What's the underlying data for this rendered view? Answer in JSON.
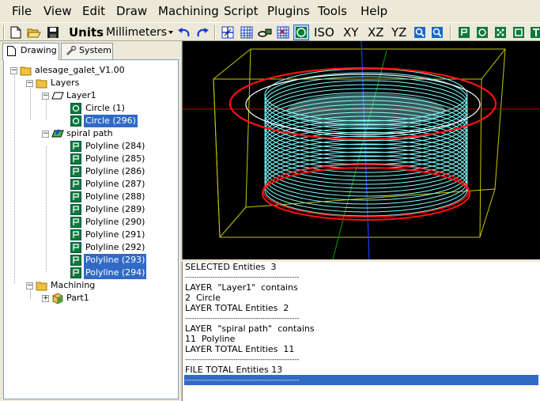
{
  "menu": [
    "File",
    "View",
    "Edit",
    "Draw",
    "Machining",
    "Script",
    "Plugins",
    "Tools",
    "Help"
  ],
  "toolbar": {
    "units_label": "Units",
    "units_value": "Millimeters",
    "view_iso": "ISO",
    "view_xy": "XY",
    "view_xz": "XZ",
    "view_yz": "YZ"
  },
  "tabs": {
    "drawing": "Drawing",
    "system": "System"
  },
  "tree": {
    "root": "alesage_galet_V1.00",
    "layers": "Layers",
    "layer1": "Layer1",
    "layer1_items": [
      "Circle (1)",
      "Circle (296)"
    ],
    "spiral": "spiral path",
    "spiral_items": [
      "Polyline (284)",
      "Polyline (285)",
      "Polyline (286)",
      "Polyline (287)",
      "Polyline (288)",
      "Polyline (289)",
      "Polyline (290)",
      "Polyline (291)",
      "Polyline (292)",
      "Polyline (293)",
      "Polyline (294)"
    ],
    "machining": "Machining",
    "part1": "Part1"
  },
  "output": {
    "lines": [
      "SELECTED Entities  3",
      "--------------------------------------------------",
      "LAYER  \"Layer1\"  contains",
      "2  Circle",
      "LAYER TOTAL Entities  2",
      "--------------------------------------------------",
      "LAYER  \"spiral path\"  contains",
      "11  Polyline",
      "LAYER TOTAL Entities  11",
      "--------------------------------------------------",
      "FILE TOTAL Entities 13",
      "--------------------------------------------------"
    ]
  },
  "colors": {
    "selection": "#316ac5",
    "viewport_bg": "#000000",
    "toolpath": "#7fffff",
    "bounding_box": "#c8c800",
    "circle": "#ff0000"
  },
  "icons": [
    "new-icon",
    "open-icon",
    "save-icon",
    "undo-icon",
    "redo-icon",
    "grid-icon",
    "table-icon",
    "link-icon",
    "grid2-icon",
    "circle-view-icon",
    "zoom-fit-icon",
    "zoom-icon",
    "polyline-icon",
    "circle-icon",
    "points-icon",
    "rectangle-icon",
    "text-icon"
  ]
}
